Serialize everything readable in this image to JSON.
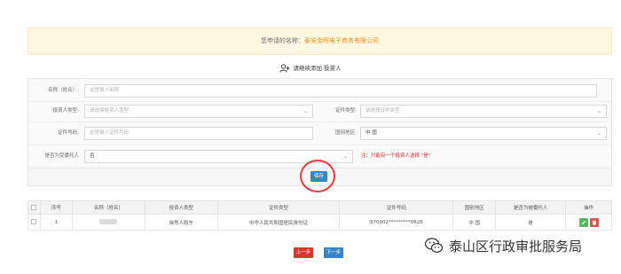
{
  "banner": {
    "prefix": "您申请的名称：",
    "company": "泰安金晖电子商务有限公司"
  },
  "section": {
    "icon": "add-user-icon",
    "title": "请继续添加 投资人"
  },
  "form": {
    "name": {
      "label": "名称（姓名）:",
      "placeholder": "这里输入名称"
    },
    "investor_type": {
      "label": "投资人类型:",
      "value": "请选择投资人类型"
    },
    "cert_type": {
      "label": "证件类型:",
      "value": "请选择证件类型"
    },
    "cert_no": {
      "label": "证件号码:",
      "placeholder": "这里输入证件号码"
    },
    "region": {
      "label": "国别地区:",
      "value": "中 国"
    },
    "trustee": {
      "label": "是否为受委托人",
      "value": "否",
      "hint": "注：只能有一个投资人选择 \"是\""
    }
  },
  "save_label": "保存",
  "table": {
    "headers": [
      "",
      "序号",
      "名称（姓名）",
      "投资人类型",
      "证件类型",
      "证件号码",
      "国别地区",
      "是否为被委托人",
      "操作"
    ],
    "rows": [
      {
        "index": "1",
        "investor_type": "自然人股东",
        "cert_type": "中华人民共和国居民身份证",
        "cert_no": "370902*********0628",
        "region": "中 国",
        "trustee": "是"
      }
    ]
  },
  "nav": {
    "prev": "上一步",
    "next": "下一步"
  },
  "watermark": {
    "text": "泰山区行政审批服务局"
  },
  "colors": {
    "accent_blue": "#3a84c6",
    "danger_red": "#d9372f",
    "annotation_red": "#ef3b3b",
    "banner_bg": "#fdf8e1",
    "company_orange": "#f08d1e"
  }
}
